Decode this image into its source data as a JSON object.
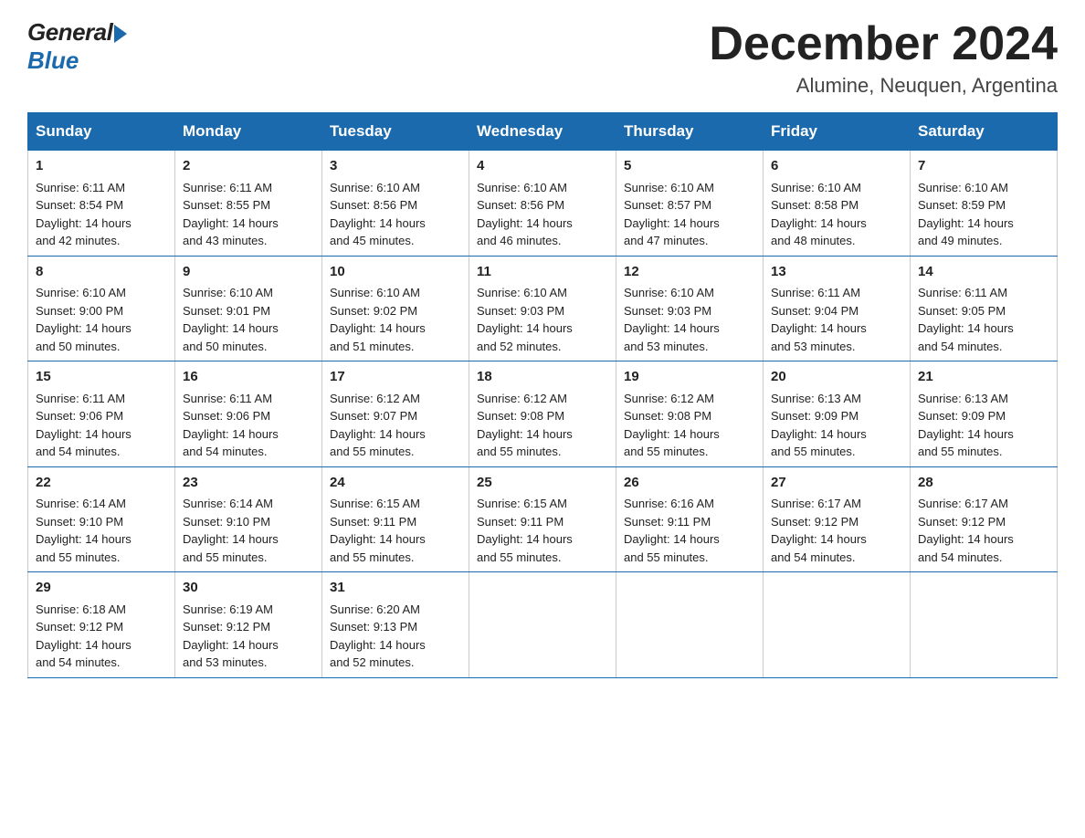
{
  "logo": {
    "general": "General",
    "blue": "Blue"
  },
  "title": {
    "month": "December 2024",
    "location": "Alumine, Neuquen, Argentina"
  },
  "headers": [
    "Sunday",
    "Monday",
    "Tuesday",
    "Wednesday",
    "Thursday",
    "Friday",
    "Saturday"
  ],
  "weeks": [
    [
      {
        "day": "1",
        "sunrise": "6:11 AM",
        "sunset": "8:54 PM",
        "daylight": "14 hours and 42 minutes."
      },
      {
        "day": "2",
        "sunrise": "6:11 AM",
        "sunset": "8:55 PM",
        "daylight": "14 hours and 43 minutes."
      },
      {
        "day": "3",
        "sunrise": "6:10 AM",
        "sunset": "8:56 PM",
        "daylight": "14 hours and 45 minutes."
      },
      {
        "day": "4",
        "sunrise": "6:10 AM",
        "sunset": "8:56 PM",
        "daylight": "14 hours and 46 minutes."
      },
      {
        "day": "5",
        "sunrise": "6:10 AM",
        "sunset": "8:57 PM",
        "daylight": "14 hours and 47 minutes."
      },
      {
        "day": "6",
        "sunrise": "6:10 AM",
        "sunset": "8:58 PM",
        "daylight": "14 hours and 48 minutes."
      },
      {
        "day": "7",
        "sunrise": "6:10 AM",
        "sunset": "8:59 PM",
        "daylight": "14 hours and 49 minutes."
      }
    ],
    [
      {
        "day": "8",
        "sunrise": "6:10 AM",
        "sunset": "9:00 PM",
        "daylight": "14 hours and 50 minutes."
      },
      {
        "day": "9",
        "sunrise": "6:10 AM",
        "sunset": "9:01 PM",
        "daylight": "14 hours and 50 minutes."
      },
      {
        "day": "10",
        "sunrise": "6:10 AM",
        "sunset": "9:02 PM",
        "daylight": "14 hours and 51 minutes."
      },
      {
        "day": "11",
        "sunrise": "6:10 AM",
        "sunset": "9:03 PM",
        "daylight": "14 hours and 52 minutes."
      },
      {
        "day": "12",
        "sunrise": "6:10 AM",
        "sunset": "9:03 PM",
        "daylight": "14 hours and 53 minutes."
      },
      {
        "day": "13",
        "sunrise": "6:11 AM",
        "sunset": "9:04 PM",
        "daylight": "14 hours and 53 minutes."
      },
      {
        "day": "14",
        "sunrise": "6:11 AM",
        "sunset": "9:05 PM",
        "daylight": "14 hours and 54 minutes."
      }
    ],
    [
      {
        "day": "15",
        "sunrise": "6:11 AM",
        "sunset": "9:06 PM",
        "daylight": "14 hours and 54 minutes."
      },
      {
        "day": "16",
        "sunrise": "6:11 AM",
        "sunset": "9:06 PM",
        "daylight": "14 hours and 54 minutes."
      },
      {
        "day": "17",
        "sunrise": "6:12 AM",
        "sunset": "9:07 PM",
        "daylight": "14 hours and 55 minutes."
      },
      {
        "day": "18",
        "sunrise": "6:12 AM",
        "sunset": "9:08 PM",
        "daylight": "14 hours and 55 minutes."
      },
      {
        "day": "19",
        "sunrise": "6:12 AM",
        "sunset": "9:08 PM",
        "daylight": "14 hours and 55 minutes."
      },
      {
        "day": "20",
        "sunrise": "6:13 AM",
        "sunset": "9:09 PM",
        "daylight": "14 hours and 55 minutes."
      },
      {
        "day": "21",
        "sunrise": "6:13 AM",
        "sunset": "9:09 PM",
        "daylight": "14 hours and 55 minutes."
      }
    ],
    [
      {
        "day": "22",
        "sunrise": "6:14 AM",
        "sunset": "9:10 PM",
        "daylight": "14 hours and 55 minutes."
      },
      {
        "day": "23",
        "sunrise": "6:14 AM",
        "sunset": "9:10 PM",
        "daylight": "14 hours and 55 minutes."
      },
      {
        "day": "24",
        "sunrise": "6:15 AM",
        "sunset": "9:11 PM",
        "daylight": "14 hours and 55 minutes."
      },
      {
        "day": "25",
        "sunrise": "6:15 AM",
        "sunset": "9:11 PM",
        "daylight": "14 hours and 55 minutes."
      },
      {
        "day": "26",
        "sunrise": "6:16 AM",
        "sunset": "9:11 PM",
        "daylight": "14 hours and 55 minutes."
      },
      {
        "day": "27",
        "sunrise": "6:17 AM",
        "sunset": "9:12 PM",
        "daylight": "14 hours and 54 minutes."
      },
      {
        "day": "28",
        "sunrise": "6:17 AM",
        "sunset": "9:12 PM",
        "daylight": "14 hours and 54 minutes."
      }
    ],
    [
      {
        "day": "29",
        "sunrise": "6:18 AM",
        "sunset": "9:12 PM",
        "daylight": "14 hours and 54 minutes."
      },
      {
        "day": "30",
        "sunrise": "6:19 AM",
        "sunset": "9:12 PM",
        "daylight": "14 hours and 53 minutes."
      },
      {
        "day": "31",
        "sunrise": "6:20 AM",
        "sunset": "9:13 PM",
        "daylight": "14 hours and 52 minutes."
      },
      null,
      null,
      null,
      null
    ]
  ],
  "labels": {
    "sunrise": "Sunrise:",
    "sunset": "Sunset:",
    "daylight": "Daylight:"
  }
}
